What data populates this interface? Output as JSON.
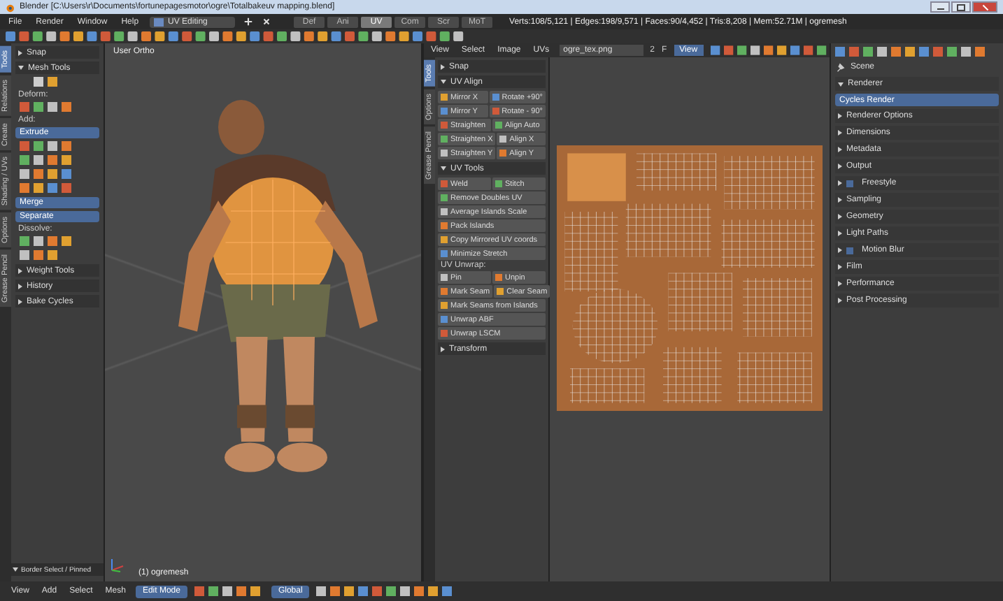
{
  "title_bar": {
    "title": "Blender [C:\\Users\\r\\Documents\\fortunepagesmotor\\ogre\\Totalbakeuv mapping.blend]"
  },
  "menu_bar": {
    "menus": [
      "File",
      "Render",
      "Window",
      "Help"
    ],
    "layout": "UV Editing",
    "screen_tabs": [
      {
        "label": "Def",
        "selected": false
      },
      {
        "label": "Ani",
        "selected": false
      },
      {
        "label": "UV",
        "selected": true
      },
      {
        "label": "Com",
        "selected": false
      },
      {
        "label": "Scr",
        "selected": false
      },
      {
        "label": "MoT",
        "selected": false
      }
    ],
    "stats": "Verts:108/5,121 | Edges:198/9,571 | Faces:90/4,452 | Tris:8,208 | Mem:52.71M | ogremesh"
  },
  "left_panel": {
    "tabs": [
      {
        "label": "Tools",
        "selected": true
      },
      {
        "label": "Relations",
        "selected": false
      },
      {
        "label": "Create",
        "selected": false
      },
      {
        "label": "Shading / UVs",
        "selected": false
      },
      {
        "label": "Options",
        "selected": false
      },
      {
        "label": "Grease Pencil",
        "selected": false
      }
    ],
    "panels_top": [
      {
        "title": "Snap",
        "expanded": false
      },
      {
        "title": "Mesh Tools",
        "expanded": true
      }
    ],
    "deform_label": "Deform:",
    "add_label": "Add:",
    "extrude": "Extrude",
    "merge": "Merge",
    "separate": "Separate",
    "dissolve_label": "Dissolve:",
    "panels_bottom": [
      {
        "title": "Weight Tools",
        "expanded": false
      },
      {
        "title": "History",
        "expanded": false
      },
      {
        "title": "Bake Cycles",
        "expanded": false
      }
    ],
    "operator_panel": {
      "title": "Border Select / Pinned",
      "expanded": true
    }
  },
  "viewport": {
    "view_label": "User Ortho",
    "object_label": "(1) ogremesh"
  },
  "uv_editor": {
    "menus": [
      "View",
      "Select",
      "Image",
      "UVs"
    ],
    "image_name": "ogre_tex.png",
    "users": "2",
    "fake_user": "F",
    "view_mode": "View",
    "tabs": [
      {
        "label": "Tools",
        "selected": true
      },
      {
        "label": "Options",
        "selected": false
      },
      {
        "label": "Grease Pencil",
        "selected": false
      }
    ],
    "snap": {
      "title": "Snap",
      "expanded": false
    },
    "align": {
      "title": "UV Align",
      "expanded": true,
      "rows": [
        [
          "Mirror X",
          "Rotate +90°"
        ],
        [
          "Mirror Y",
          "Rotate - 90°"
        ],
        [
          "Straighten",
          "Align Auto"
        ],
        [
          "Straighten X",
          "Align X"
        ],
        [
          "Straighten Y",
          "Align Y"
        ]
      ]
    },
    "tools": {
      "title": "UV Tools",
      "expanded": true,
      "rows": [
        [
          "Weld",
          "Stitch"
        ],
        [
          "Remove Doubles UV"
        ],
        [
          "Average Islands Scale"
        ],
        [
          "Pack Islands"
        ],
        [
          "Copy Mirrored UV coords"
        ],
        [
          "Minimize Stretch"
        ]
      ]
    },
    "unwrap_label": "UV Unwrap:",
    "unwrap_rows": [
      [
        "Pin",
        "Unpin"
      ],
      [
        "Mark Seam",
        "Clear Seam"
      ],
      [
        "Mark Seams from Islands"
      ],
      [
        "Unwrap ABF"
      ],
      [
        "Unwrap LSCM"
      ]
    ],
    "transform": {
      "title": "Transform",
      "expanded": false
    }
  },
  "properties": {
    "context": "Scene",
    "render_engine": "Cycles Render",
    "panels": [
      {
        "title": "Renderer",
        "expanded": true,
        "kind": "plain"
      },
      {
        "title": "Renderer Options",
        "expanded": false,
        "kind": "plain"
      },
      {
        "title": "Dimensions",
        "expanded": false,
        "kind": "plain"
      },
      {
        "title": "Metadata",
        "expanded": false,
        "kind": "plain"
      },
      {
        "title": "Output",
        "expanded": false,
        "kind": "plain"
      },
      {
        "title": "Freestyle",
        "expanded": false,
        "kind": "toggle",
        "checked": false
      },
      {
        "title": "Sampling",
        "expanded": false,
        "kind": "plain"
      },
      {
        "title": "Geometry",
        "expanded": false,
        "kind": "plain"
      },
      {
        "title": "Light Paths",
        "expanded": false,
        "kind": "plain"
      },
      {
        "title": "Motion Blur",
        "expanded": false,
        "kind": "toggle",
        "checked": false
      },
      {
        "title": "Film",
        "expanded": false,
        "kind": "plain"
      },
      {
        "title": "Performance",
        "expanded": false,
        "kind": "plain"
      },
      {
        "title": "Post Processing",
        "expanded": false,
        "kind": "plain"
      }
    ]
  },
  "bottom_bar": {
    "menus": [
      "View",
      "Add",
      "Select",
      "Mesh"
    ],
    "mode": "Edit Mode",
    "orientation": "Global"
  }
}
